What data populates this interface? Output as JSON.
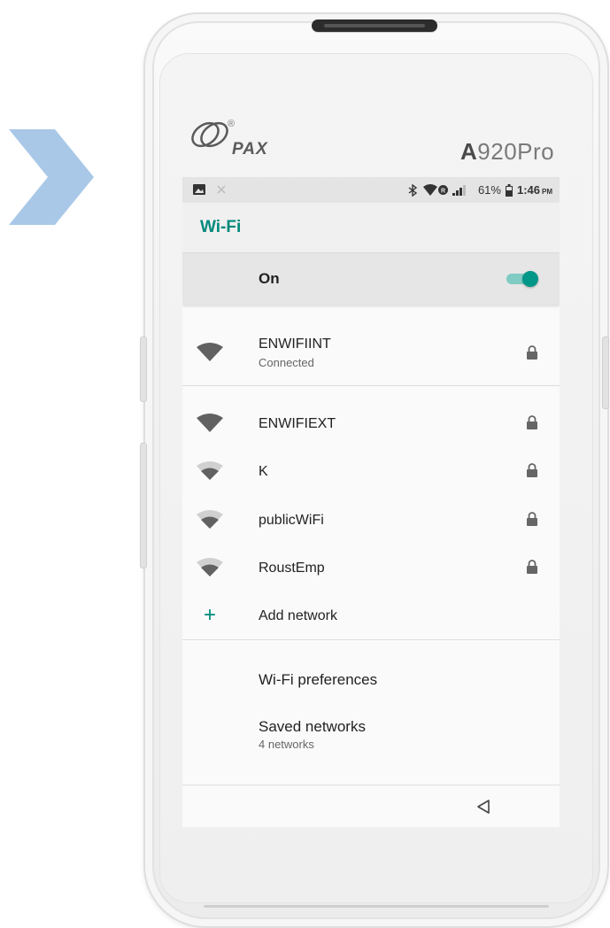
{
  "device": {
    "brand": "PAX",
    "registered_mark": "®",
    "model_prefix": "A",
    "model_suffix": "920Pro"
  },
  "status_bar": {
    "battery": "61%",
    "time": "1:46",
    "ampm": "PM",
    "icons": [
      "image-icon",
      "notification-muted-icon",
      "bluetooth-icon",
      "wifi-icon",
      "data-icon",
      "signal-icon",
      "battery-icon"
    ]
  },
  "header": {
    "title": "Wi-Fi"
  },
  "master_switch": {
    "label": "On",
    "state": true,
    "accent_color": "#009688"
  },
  "connected_network": {
    "name": "ENWIFIINT",
    "status": "Connected",
    "secured": true
  },
  "networks": [
    {
      "name": "ENWIFIEXT",
      "secured": true,
      "signal": "strong"
    },
    {
      "name": "K",
      "secured": true,
      "signal": "medium"
    },
    {
      "name": "publicWiFi",
      "secured": true,
      "signal": "medium"
    },
    {
      "name": "RoustEmp",
      "secured": true,
      "signal": "medium"
    }
  ],
  "add_network": {
    "label": "Add network"
  },
  "preferences": {
    "wifi_preferences": "Wi-Fi preferences",
    "saved_networks": "Saved networks",
    "saved_networks_sub": "4 networks"
  },
  "colors": {
    "accent": "#00897b",
    "chevron": "#a9c8e8"
  }
}
